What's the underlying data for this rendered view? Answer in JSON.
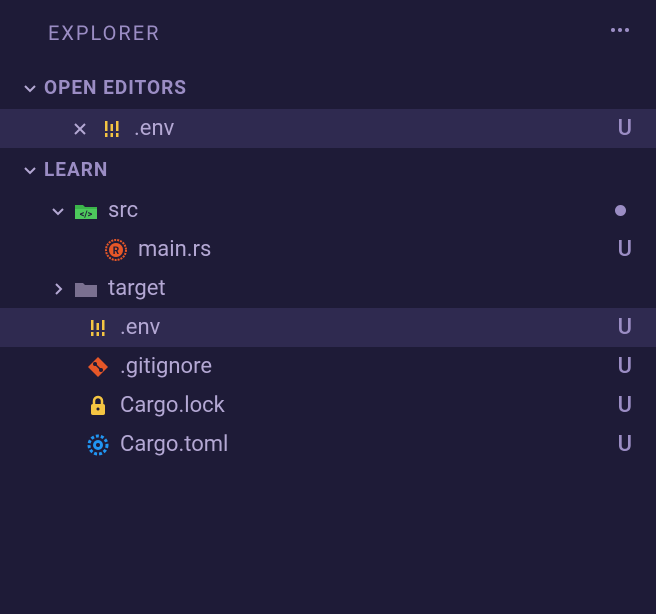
{
  "header": {
    "title": "EXPLORER"
  },
  "sections": {
    "open_editors": {
      "title": "OPEN EDITORS",
      "items": [
        {
          "label": ".env",
          "status": "U"
        }
      ]
    },
    "project": {
      "title": "LEARN",
      "tree": {
        "src": {
          "label": "src",
          "status_dot": true,
          "children": {
            "main_rs": {
              "label": "main.rs",
              "status": "U"
            }
          }
        },
        "target": {
          "label": "target"
        },
        "env": {
          "label": ".env",
          "status": "U",
          "selected": true
        },
        "gitignore": {
          "label": ".gitignore",
          "status": "U"
        },
        "cargo_lock": {
          "label": "Cargo.lock",
          "status": "U"
        },
        "cargo_toml": {
          "label": "Cargo.toml",
          "status": "U"
        }
      }
    }
  }
}
